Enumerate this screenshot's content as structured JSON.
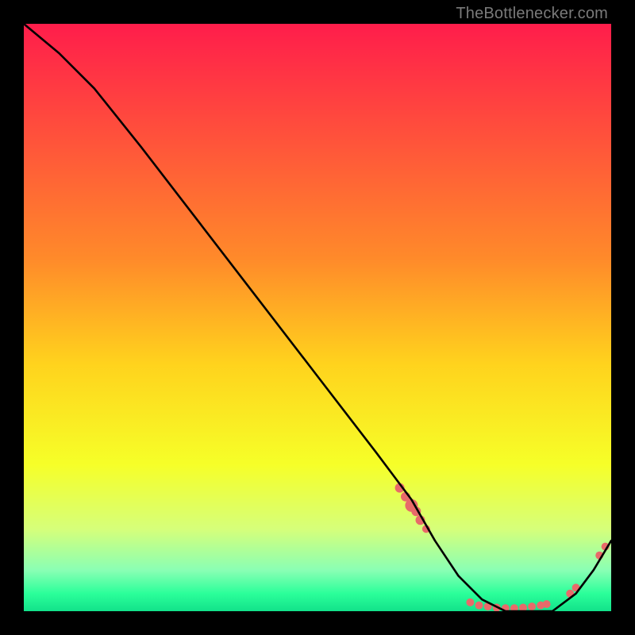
{
  "watermark": "TheBottlenecker.com",
  "chart_data": {
    "type": "line",
    "title": "",
    "xlabel": "",
    "ylabel": "",
    "xlim": [
      0,
      100
    ],
    "ylim": [
      0,
      100
    ],
    "gradient_stops": [
      {
        "offset": 0,
        "color": "#ff1d4b"
      },
      {
        "offset": 0.4,
        "color": "#ff8a2a"
      },
      {
        "offset": 0.58,
        "color": "#ffd31d"
      },
      {
        "offset": 0.75,
        "color": "#f6ff28"
      },
      {
        "offset": 0.86,
        "color": "#d6ff7a"
      },
      {
        "offset": 0.93,
        "color": "#8affb4"
      },
      {
        "offset": 0.97,
        "color": "#2bff9a"
      },
      {
        "offset": 1.0,
        "color": "#12e28a"
      }
    ],
    "series": [
      {
        "name": "bottleneck-curve",
        "x": [
          0,
          6,
          12,
          20,
          30,
          40,
          50,
          60,
          66,
          70,
          74,
          78,
          82,
          86,
          90,
          94,
          97,
          100
        ],
        "y": [
          100,
          95,
          89,
          79,
          66,
          53,
          40,
          27,
          19,
          12,
          6,
          2,
          0,
          0,
          0,
          3,
          7,
          12
        ]
      }
    ],
    "markers": [
      {
        "x": 64.0,
        "y": 21.0,
        "r": 6
      },
      {
        "x": 65.0,
        "y": 19.5,
        "r": 6
      },
      {
        "x": 66.0,
        "y": 18.0,
        "r": 8
      },
      {
        "x": 66.8,
        "y": 17.0,
        "r": 6
      },
      {
        "x": 67.5,
        "y": 15.5,
        "r": 6
      },
      {
        "x": 68.5,
        "y": 14.0,
        "r": 5
      },
      {
        "x": 76.0,
        "y": 1.5,
        "r": 5
      },
      {
        "x": 77.5,
        "y": 1.0,
        "r": 5
      },
      {
        "x": 79.0,
        "y": 0.8,
        "r": 5
      },
      {
        "x": 80.5,
        "y": 0.6,
        "r": 5
      },
      {
        "x": 82.0,
        "y": 0.5,
        "r": 5
      },
      {
        "x": 83.5,
        "y": 0.5,
        "r": 5
      },
      {
        "x": 85.0,
        "y": 0.6,
        "r": 5
      },
      {
        "x": 86.5,
        "y": 0.8,
        "r": 5
      },
      {
        "x": 88.0,
        "y": 1.0,
        "r": 5
      },
      {
        "x": 89.0,
        "y": 1.2,
        "r": 5
      },
      {
        "x": 93.0,
        "y": 3.0,
        "r": 5
      },
      {
        "x": 94.0,
        "y": 4.0,
        "r": 5
      },
      {
        "x": 98.0,
        "y": 9.5,
        "r": 5
      },
      {
        "x": 99.0,
        "y": 11.0,
        "r": 5
      }
    ],
    "marker_color": "#e86a6a",
    "line_color": "#000000",
    "line_width": 2.6
  }
}
